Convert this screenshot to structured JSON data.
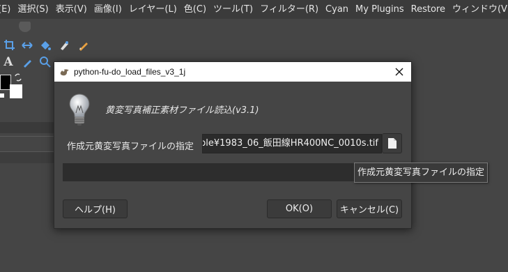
{
  "menubar": {
    "items": [
      "(E)",
      "選択(S)",
      "表示(V)",
      "画像(I)",
      "レイヤー(L)",
      "色(C)",
      "ツール(T)",
      "フィルター(R)",
      "Cyan",
      "My Plugins",
      "Restore",
      "ウィンドウ(V"
    ]
  },
  "toolbox": {
    "icons": [
      "crop-icon",
      "transform-icon",
      "bucket-fill-icon",
      "smudge-icon",
      "pencil-icon",
      "text-icon",
      "color-picker-icon",
      "zoom-icon"
    ],
    "text_tool_label": "A",
    "colors": {
      "foreground": "#000000",
      "background": "#ffffff"
    }
  },
  "dialog": {
    "title": "python-fu-do_load_files_v3_1j",
    "heading": "黄変写真補正素材ファイル読込(v3.1)",
    "file_label": "作成元黄変写真ファイルの指定",
    "file_path": "ple¥1983_06_飯田線HR400NC_0010s.tif",
    "tooltip": "作成元黄変写真ファイルの指定",
    "buttons": {
      "help": "ヘルプ(H)",
      "ok": "OK(O)",
      "cancel": "キャンセル(C)"
    }
  }
}
